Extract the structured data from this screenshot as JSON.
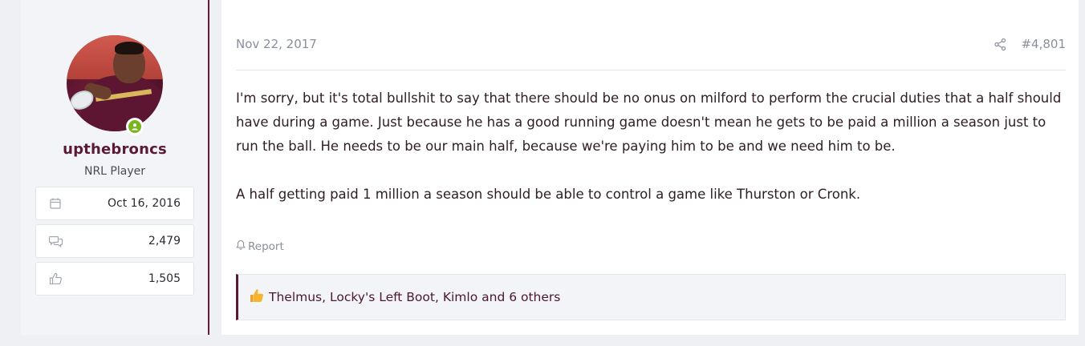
{
  "user": {
    "username": "upthebroncs",
    "title": "NRL Player",
    "stats": [
      {
        "icon": "calendar-icon",
        "value": "Oct 16, 2016"
      },
      {
        "icon": "messages-icon",
        "value": "2,479"
      },
      {
        "icon": "thumbs-up-icon",
        "value": "1,505"
      }
    ]
  },
  "post": {
    "date": "Nov 22, 2017",
    "number": "#4,801",
    "paragraphs": [
      "I'm sorry, but it's total bullshit to say that there should be no onus on milford to perform the crucial duties that a half should have during a game. Just because he has a good running game doesn't mean he gets to be paid a million a season just to run the ball. He needs to be our main half, because we're paying him to be and we need him to be.",
      "A half getting paid 1 million a season should be able to control a game like Thurston or Cronk."
    ],
    "report_label": "Report",
    "reactions": "Thelmus, Locky's Left Boot, Kimlo and 6 others"
  },
  "colors": {
    "accent": "#5a1a35",
    "online": "#7bb51d",
    "muted": "#8a8f9c"
  }
}
